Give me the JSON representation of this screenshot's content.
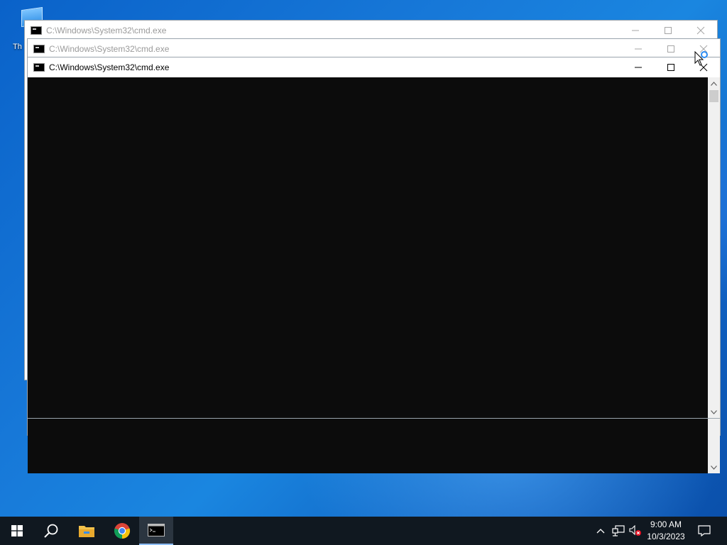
{
  "desktop": {
    "icon_label": "Th"
  },
  "windows": [
    {
      "title": "C:\\Windows\\System32\\cmd.exe",
      "state": "inactive"
    },
    {
      "title": "C:\\Windows\\System32\\cmd.exe",
      "state": "inactive"
    },
    {
      "title": "C:\\Windows\\System32\\cmd.exe",
      "state": "active"
    }
  ],
  "taskbar": {
    "apps": [
      "start-icon",
      "search-icon",
      "file-explorer-icon",
      "chrome-icon",
      "cmd-icon"
    ],
    "clock": {
      "time": "9:00 AM",
      "date": "10/3/2023"
    }
  },
  "colors": {
    "console_bg": "#0c0c0c",
    "taskbar_bg": "#101820",
    "desktop_accent": "#1778d8"
  }
}
